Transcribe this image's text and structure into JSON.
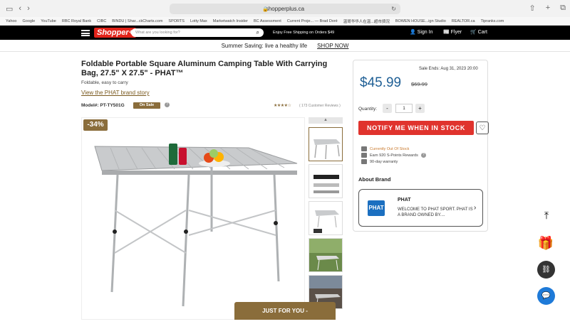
{
  "browser": {
    "url": "shopperplus.ca",
    "bookmarks": [
      "Yahoo",
      "Google",
      "YouTube",
      "RBC Royal Bank",
      "CIBC",
      "BINDU | Shar...ckCharts.com",
      "SPORTS",
      "Lotty Max",
      "Marketwatch Insider",
      "BC Assessment",
      "Current Proje... — Brad Doré",
      "温哥华华人在温...超市擠況",
      "BOWEN HOUSE...ign Studio",
      "REALTOR.ca",
      "Tipranks.com"
    ]
  },
  "header": {
    "logo": "Shopper+",
    "search_placeholder": "What are you looking for?",
    "shipping": "Enjoy Free Shipping on Orders $49",
    "signin": "Sign In",
    "flyer": "Flyer",
    "cart": "Cart"
  },
  "promo": {
    "text": "Summer Saving: live a healthy life",
    "link": "SHOP NOW"
  },
  "product": {
    "title": "Foldable Portable Square Aluminum Camping Table With Carrying Bag, 27.5\" X 27.5\" - PHAT™",
    "subtitle": "Foldable, easy to carry",
    "brand_story": "View the PHAT brand story",
    "model": "Model#: PT-TY501G",
    "on_sale": "On Sale",
    "info": "?",
    "stars": "★★★★☆",
    "rating": 4.5,
    "reviews": "( 173 Customer Reviews )",
    "discount": "-34%"
  },
  "buy": {
    "sale_ends": "Sale Ends: Aug 31, 2023 20:00",
    "price": "$45.99",
    "old_price": "$69.99",
    "qty_label": "Quantity:",
    "qty_minus": "-",
    "qty_value": "1",
    "qty_plus": "+",
    "notify": "NOTIFY ME WHEN IN STOCK",
    "heart": "♡",
    "features": [
      "Currently Out Of Stock",
      "Earn 920 S-Points Rewards",
      "90-day warranty"
    ],
    "feature_info": "?"
  },
  "brand": {
    "heading": "About Brand",
    "logo": "PHAT",
    "name": "PHAT",
    "desc": "WELCOME TO PHAT SPORT. PHAT IS A BRAND OWNED BY....",
    "arrow": "›"
  },
  "footer": {
    "just_for_you": "JUST FOR YOU  -"
  },
  "colors": {
    "accent": "#8a6d3b",
    "price": "#1f5f95",
    "notify": "#e0332d",
    "out_of_stock": "#c97a2e"
  }
}
